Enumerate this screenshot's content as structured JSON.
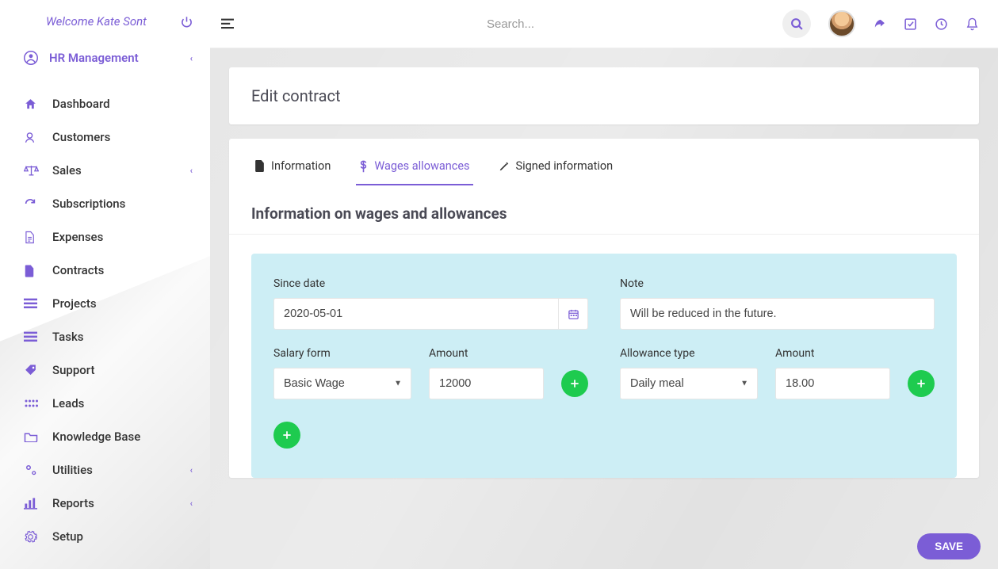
{
  "welcome": "Welcome Kate Sont",
  "section": {
    "label": "HR Management"
  },
  "sidebar": [
    {
      "label": "Dashboard",
      "icon": "home"
    },
    {
      "label": "Customers",
      "icon": "user"
    },
    {
      "label": "Sales",
      "icon": "scale",
      "chevron": true
    },
    {
      "label": "Subscriptions",
      "icon": "refresh"
    },
    {
      "label": "Expenses",
      "icon": "doc"
    },
    {
      "label": "Contracts",
      "icon": "file"
    },
    {
      "label": "Projects",
      "icon": "bars"
    },
    {
      "label": "Tasks",
      "icon": "bars"
    },
    {
      "label": "Support",
      "icon": "tag"
    },
    {
      "label": "Leads",
      "icon": "dots"
    },
    {
      "label": "Knowledge Base",
      "icon": "folder"
    },
    {
      "label": "Utilities",
      "icon": "gears",
      "chevron": true
    },
    {
      "label": "Reports",
      "icon": "chart",
      "chevron": true
    },
    {
      "label": "Setup",
      "icon": "gear"
    }
  ],
  "search_placeholder": "Search...",
  "page_title": "Edit contract",
  "tabs": {
    "info": "Information",
    "wages": "Wages allowances",
    "signed": "Signed information"
  },
  "section_heading": "Information on wages and allowances",
  "form": {
    "since_label": "Since date",
    "since_value": "2020-05-01",
    "note_label": "Note",
    "note_value": "Will be reduced in the future.",
    "salary_form_label": "Salary form",
    "salary_form_value": "Basic Wage",
    "salary_amount_label": "Amount",
    "salary_amount_value": "12000",
    "allowance_type_label": "Allowance type",
    "allowance_type_value": "Daily meal",
    "allowance_amount_label": "Amount",
    "allowance_amount_value": "18.00"
  },
  "save_label": "SAVE"
}
